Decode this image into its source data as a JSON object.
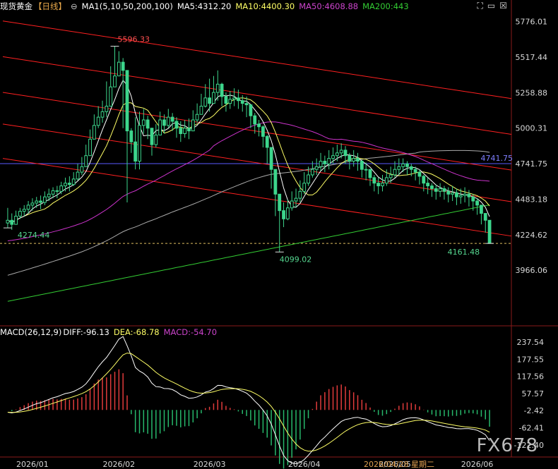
{
  "header": {
    "title": "现货黄金",
    "period": "【日线】",
    "toggle_icon": "minus-circle-icon",
    "ma_params": "MA1(5,10,50,200,100)",
    "ma5": "MA5:4312.20",
    "ma10": "MA10:4400.30",
    "ma50": "MA50:4608.88",
    "ma200": "MA200:443",
    "icons": [
      "expand-icon",
      "minimize-icon",
      "close-icon"
    ]
  },
  "macd_header": {
    "params": "MACD(26,12,9)",
    "diff": "DIFF:-96.13",
    "dea": "DEA:-68.78",
    "macd": "MACD:-54.70"
  },
  "watermark": "FX678",
  "colors": {
    "up": "#3dd68c",
    "down": "#3dd68c",
    "ma5": "#ffffff",
    "ma10": "#ffff66",
    "ma50": "#cc33cc",
    "ma200": "#33cc33",
    "ma100": "#aaaaaa",
    "channel": "#ff2020",
    "hline": "#5a5aff",
    "dashed": "#e0c060",
    "macd_pos": "#e03b3b",
    "macd_neg": "#27b86b",
    "annot_high": "#ff5050",
    "annot_low": "#55d68f"
  },
  "chart_data": [
    {
      "type": "candlestick",
      "title": "现货黄金【日线】",
      "y_ticks": [
        "5776.01",
        "5517.44",
        "5258.88",
        "5000.31",
        "4741.75",
        "4483.18",
        "4224.62",
        "3966.06"
      ],
      "x_ticks": [
        "2026/01",
        "2026/02",
        "2026/03",
        "2026/04",
        "2026/05",
        "2026/06"
      ],
      "cursor_label": "2026/04/28 星期二",
      "ylim": [
        3880,
        5840
      ],
      "annotations": [
        {
          "label": "5596.33",
          "value": 5596.33
        },
        {
          "label": "4274.44",
          "value": 4274.44
        },
        {
          "label": "4099.02",
          "value": 4099.02
        },
        {
          "label": "4161.48",
          "value": 4161.48
        }
      ],
      "horizontal_line": {
        "label": "4741.75",
        "value": 4741.75
      },
      "dashed_line": 4161.48,
      "series": [
        {
          "name": "MA5",
          "values": []
        },
        {
          "name": "MA10",
          "values": []
        },
        {
          "name": "MA50",
          "values": []
        },
        {
          "name": "MA200",
          "values": []
        }
      ],
      "close": [
        4330,
        4300,
        4360,
        4395,
        4410,
        4440,
        4455,
        4470,
        4460,
        4500,
        4520,
        4545,
        4540,
        4580,
        4600,
        4590,
        4630,
        4680,
        4720,
        4800,
        4920,
        5020,
        5080,
        5120,
        5160,
        5300,
        5380,
        5480,
        5420,
        4980,
        4900,
        4760,
        5020,
        5060,
        5000,
        4880,
        4950,
        5060,
        5020,
        5080,
        5050,
        5000,
        4960,
        5000,
        4980,
        5060,
        5100,
        5160,
        5220,
        5180,
        5260,
        5320,
        5230,
        5180,
        5210,
        5220,
        5200,
        5180,
        5170,
        5090,
        5030,
        5010,
        4940,
        4860,
        4700,
        4520,
        4400,
        4340,
        4420,
        4470,
        4490,
        4540,
        4600,
        4660,
        4700,
        4720,
        4760,
        4740,
        4780,
        4800,
        4820,
        4840,
        4800,
        4760,
        4780,
        4760,
        4700,
        4700,
        4640,
        4600,
        4580,
        4600,
        4640,
        4660,
        4700,
        4720,
        4740,
        4720,
        4700,
        4680,
        4650,
        4600,
        4580,
        4560,
        4540,
        4560,
        4540,
        4520,
        4530,
        4500,
        4510,
        4520,
        4500,
        4470,
        4440,
        4380,
        4330,
        4161.48
      ],
      "high": [
        4420,
        4380,
        4400,
        4420,
        4440,
        4470,
        4490,
        4500,
        4510,
        4540,
        4560,
        4570,
        4580,
        4610,
        4640,
        4650,
        4680,
        4740,
        4790,
        4880,
        4990,
        5100,
        5160,
        5200,
        5340,
        5450,
        5596.33,
        5560,
        5510,
        5100,
        5000,
        5080,
        5120,
        5140,
        5090,
        5000,
        5030,
        5120,
        5100,
        5140,
        5110,
        5080,
        5050,
        5060,
        5070,
        5130,
        5180,
        5250,
        5320,
        5360,
        5380,
        5420,
        5330,
        5260,
        5270,
        5290,
        5280,
        5240,
        5230,
        5160,
        5110,
        5060,
        5020,
        4950,
        4800,
        4640,
        4500,
        4460,
        4480,
        4540,
        4560,
        4620,
        4680,
        4720,
        4760,
        4780,
        4820,
        4800,
        4840,
        4860,
        4880,
        4890,
        4870,
        4820,
        4840,
        4820,
        4770,
        4750,
        4700,
        4660,
        4640,
        4660,
        4700,
        4720,
        4760,
        4780,
        4780,
        4760,
        4740,
        4720,
        4700,
        4660,
        4640,
        4600,
        4590,
        4600,
        4580,
        4570,
        4580,
        4560,
        4560,
        4570,
        4550,
        4520,
        4490,
        4440,
        4380,
        4240
      ],
      "low": [
        4274.44,
        4260,
        4300,
        4340,
        4360,
        4380,
        4400,
        4420,
        4410,
        4440,
        4470,
        4490,
        4490,
        4520,
        4540,
        4540,
        4580,
        4620,
        4660,
        4720,
        4840,
        4940,
        5000,
        5040,
        5080,
        5200,
        5300,
        5380,
        5000,
        4460,
        4820,
        4700,
        4700,
        4960,
        4920,
        4800,
        4860,
        4960,
        4960,
        5000,
        4980,
        4930,
        4900,
        4930,
        4920,
        4980,
        5040,
        5100,
        5150,
        5120,
        5180,
        5200,
        5160,
        5120,
        5140,
        5160,
        5140,
        5120,
        5080,
        5000,
        4960,
        4940,
        4860,
        4740,
        4560,
        4360,
        4099.02,
        4280,
        4330,
        4400,
        4420,
        4460,
        4520,
        4580,
        4640,
        4660,
        4690,
        4680,
        4700,
        4740,
        4760,
        4780,
        4740,
        4700,
        4720,
        4690,
        4640,
        4620,
        4580,
        4540,
        4520,
        4540,
        4580,
        4600,
        4640,
        4660,
        4680,
        4660,
        4650,
        4620,
        4590,
        4540,
        4520,
        4500,
        4480,
        4500,
        4480,
        4460,
        4470,
        4440,
        4450,
        4460,
        4430,
        4400,
        4370,
        4300,
        4240,
        4161.48
      ]
    },
    {
      "type": "bar",
      "title": "MACD(26,12,9)",
      "y_ticks": [
        "237.54",
        "177.55",
        "117.56",
        "57.57",
        "-2.42",
        "-62.41",
        "-122.40"
      ],
      "ylim": [
        -150,
        260
      ],
      "series": [
        {
          "name": "DIFF",
          "values": []
        },
        {
          "name": "DEA",
          "values": []
        },
        {
          "name": "MACD",
          "values": []
        }
      ]
    }
  ]
}
